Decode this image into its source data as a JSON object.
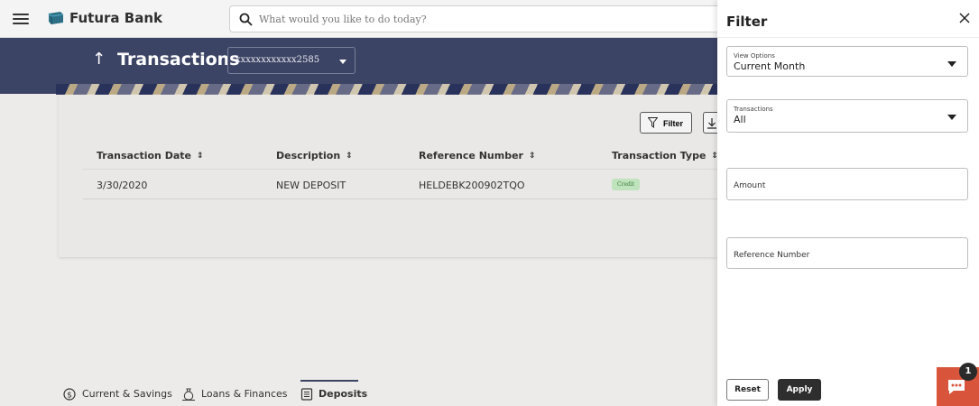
{
  "topbar": {
    "brand": "Futura Bank",
    "search_placeholder": "What would you like to do today?"
  },
  "header": {
    "title": "Transactions",
    "account": "xxxxxxxxxxxx2585"
  },
  "toolbar": {
    "filter_label": "Filter"
  },
  "table": {
    "columns": [
      "Transaction Date",
      "Description",
      "Reference Number",
      "Transaction Type"
    ],
    "rows": [
      {
        "date": "3/30/2020",
        "description": "NEW DEPOSIT",
        "reference": "HELDEBK200902TQO",
        "type": "Credit"
      }
    ]
  },
  "bottom_tabs": [
    {
      "label": "Current & Savings",
      "icon": "dollar-circle-icon"
    },
    {
      "label": "Loans & Finances",
      "icon": "money-bag-icon"
    },
    {
      "label": "Deposits",
      "icon": "document-list-icon",
      "active": true
    }
  ],
  "filter_panel": {
    "title": "Filter",
    "view_options": {
      "label": "View Options",
      "value": "Current Month"
    },
    "transactions": {
      "label": "Transactions",
      "value": "All"
    },
    "amount_placeholder": "Amount",
    "reference_placeholder": "Reference Number",
    "reset_label": "Reset",
    "apply_label": "Apply"
  },
  "chat": {
    "badge_count": "1"
  },
  "colors": {
    "header": "#3c4465",
    "chat": "#d8543b",
    "credit_badge": "#bfe3bd"
  }
}
